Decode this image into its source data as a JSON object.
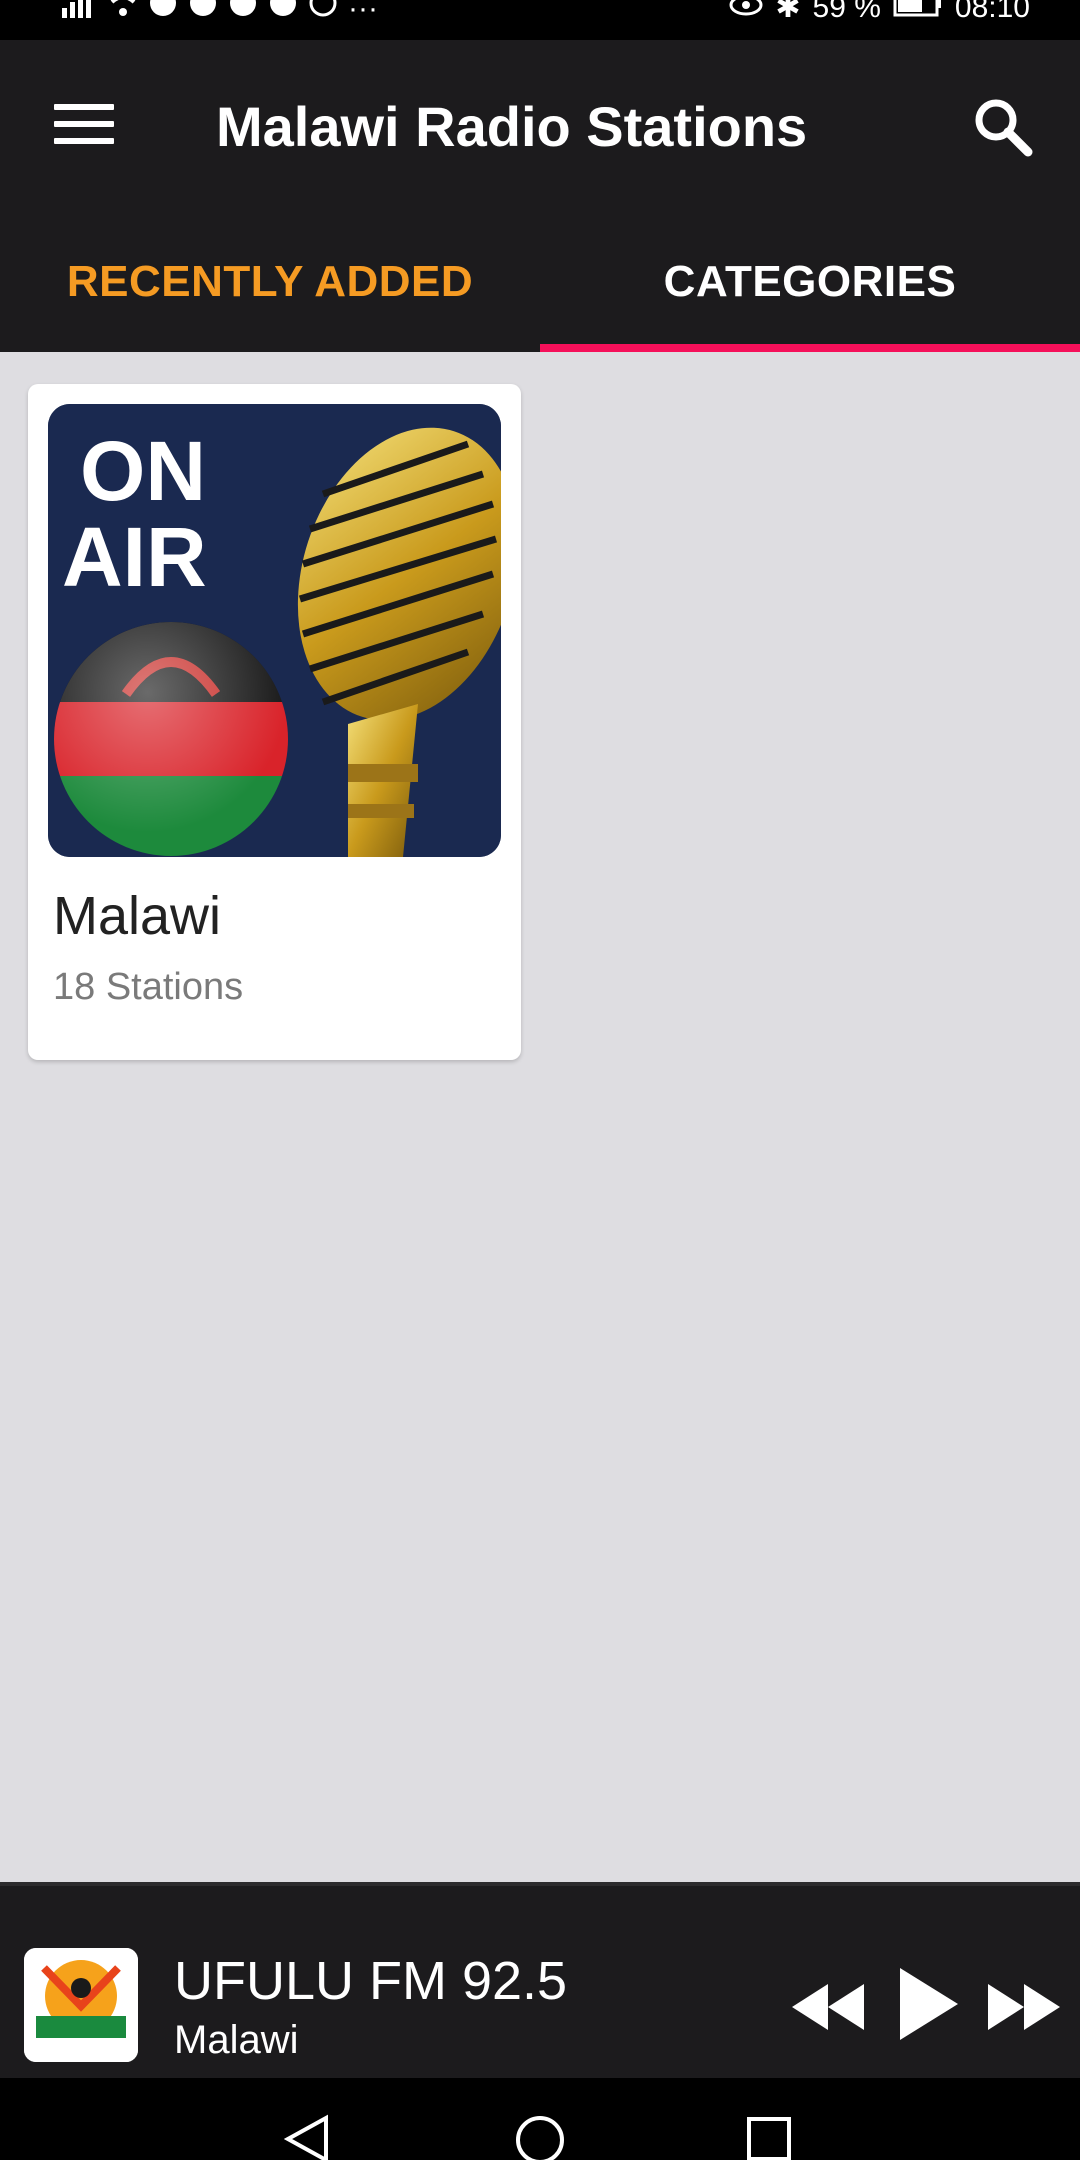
{
  "status_bar": {
    "left_icons": [
      "signal-icon",
      "wifi-icon",
      "app-icon",
      "app-icon",
      "app-icon",
      "app-icon",
      "whatsapp-icon",
      "more-icon"
    ],
    "battery_percent": "59 %",
    "time": "08:10"
  },
  "app_bar": {
    "title": "Malawi Radio Stations"
  },
  "tabs": [
    {
      "label": "RECENTLY ADDED",
      "active": false
    },
    {
      "label": "CATEGORIES",
      "active": true
    }
  ],
  "colors": {
    "app_bar": "#1c1b1d",
    "tab_inactive": "#f59b23",
    "tab_active": "#ffffff",
    "tab_indicator": "#f5105a",
    "content_bg": "#dedde1"
  },
  "categories": [
    {
      "title": "Malawi",
      "subtitle": "18 Stations",
      "art_text_line1": "ON",
      "art_text_line2": "AIR"
    }
  ],
  "player": {
    "title": "UFULU FM 92.5",
    "subtitle": "Malawi"
  },
  "nav_bar": {
    "buttons": [
      "back-icon",
      "home-icon",
      "recents-icon"
    ]
  }
}
